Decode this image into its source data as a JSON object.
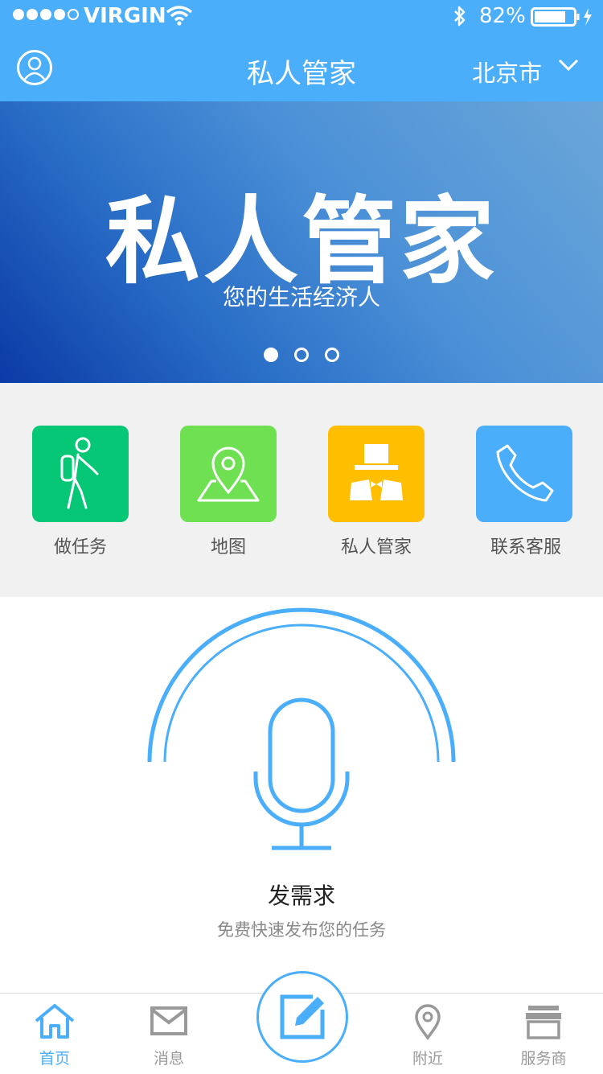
{
  "status_bar": {
    "carrier": "VIRGIN",
    "battery_percent": "82%"
  },
  "nav": {
    "title": "私人管家",
    "city": "北京市"
  },
  "banner": {
    "title": "私人管家",
    "subtitle": "您的生活经济人",
    "pages": 3,
    "active_page": 1
  },
  "grid": {
    "items": [
      {
        "label": "做任务",
        "icon": "hiker-icon",
        "color": "#05c776"
      },
      {
        "label": "地图",
        "icon": "map-pin-icon",
        "color": "#6fe052"
      },
      {
        "label": "私人管家",
        "icon": "butler-icon",
        "color": "#ffbf00"
      },
      {
        "label": "联系客服",
        "icon": "phone-icon",
        "color": "#4aaefb"
      }
    ]
  },
  "voice": {
    "title": "发需求",
    "subtitle": "免费快速发布您的任务"
  },
  "tabbar": {
    "items": [
      {
        "label": "首页",
        "icon": "home-icon",
        "active": true
      },
      {
        "label": "消息",
        "icon": "mail-icon",
        "active": false
      },
      {
        "label": "附近",
        "icon": "location-icon",
        "active": false
      },
      {
        "label": "服务商",
        "icon": "store-icon",
        "active": false
      }
    ],
    "center_icon": "edit-icon"
  },
  "colors": {
    "accent": "#4aaefb",
    "grid_bg": "#f1f1f1"
  }
}
